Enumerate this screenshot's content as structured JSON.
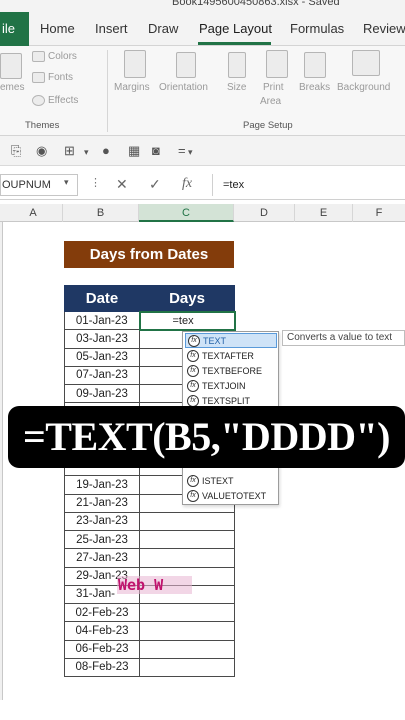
{
  "window": {
    "title": "Book1495600450863.xlsx - Saved"
  },
  "tabs": [
    {
      "label": "ile"
    },
    {
      "label": "Home"
    },
    {
      "label": "Insert"
    },
    {
      "label": "Draw"
    },
    {
      "label": "Page Layout"
    },
    {
      "label": "Formulas"
    },
    {
      "label": "Review"
    }
  ],
  "ribbon": {
    "themes": {
      "label": "emes",
      "colors": "Colors",
      "fonts": "Fonts",
      "effects": "Effects",
      "group": "Themes"
    },
    "page_setup": {
      "items": [
        "Margins",
        "Orientation",
        "Size",
        "Print Area",
        "Breaks",
        "Background"
      ],
      "print_line1": "Print",
      "print_line2": "Area",
      "group": "Page Setup"
    }
  },
  "formula_bar": {
    "name_box": "OUPNUM",
    "formula": "=tex",
    "fx": "fx"
  },
  "columns": [
    "A",
    "B",
    "C",
    "D",
    "E",
    "F"
  ],
  "sheet": {
    "heading": "Days from Dates",
    "headers": {
      "date": "Date",
      "days": "Days"
    },
    "active_input": "=tex",
    "dates": [
      "01-Jan-23",
      "03-Jan-23",
      "05-Jan-23",
      "07-Jan-23",
      "09-Jan-23",
      "",
      "",
      "",
      "",
      "19-Jan-23",
      "21-Jan-23",
      "23-Jan-23",
      "25-Jan-23",
      "27-Jan-23",
      "29-Jan-23",
      "31-Jan-",
      "02-Feb-23",
      "04-Feb-23",
      "06-Feb-23",
      "08-Feb-23"
    ]
  },
  "autocomplete": {
    "items": [
      "TEXT",
      "TEXTAFTER",
      "TEXTBEFORE",
      "TEXTJOIN",
      "TEXTSPLIT",
      "",
      "",
      "",
      "ISTEXT",
      "VALUETOTEXT"
    ],
    "selected_index": 0,
    "tooltip": "Converts a value to text"
  },
  "overlay_formula": "=TEXT(B5,\"DDDD\")",
  "watermark": "Web W",
  "colors": {
    "excel_green": "#217346",
    "heading_brown": "#833c0b",
    "header_navy": "#1f3864"
  }
}
